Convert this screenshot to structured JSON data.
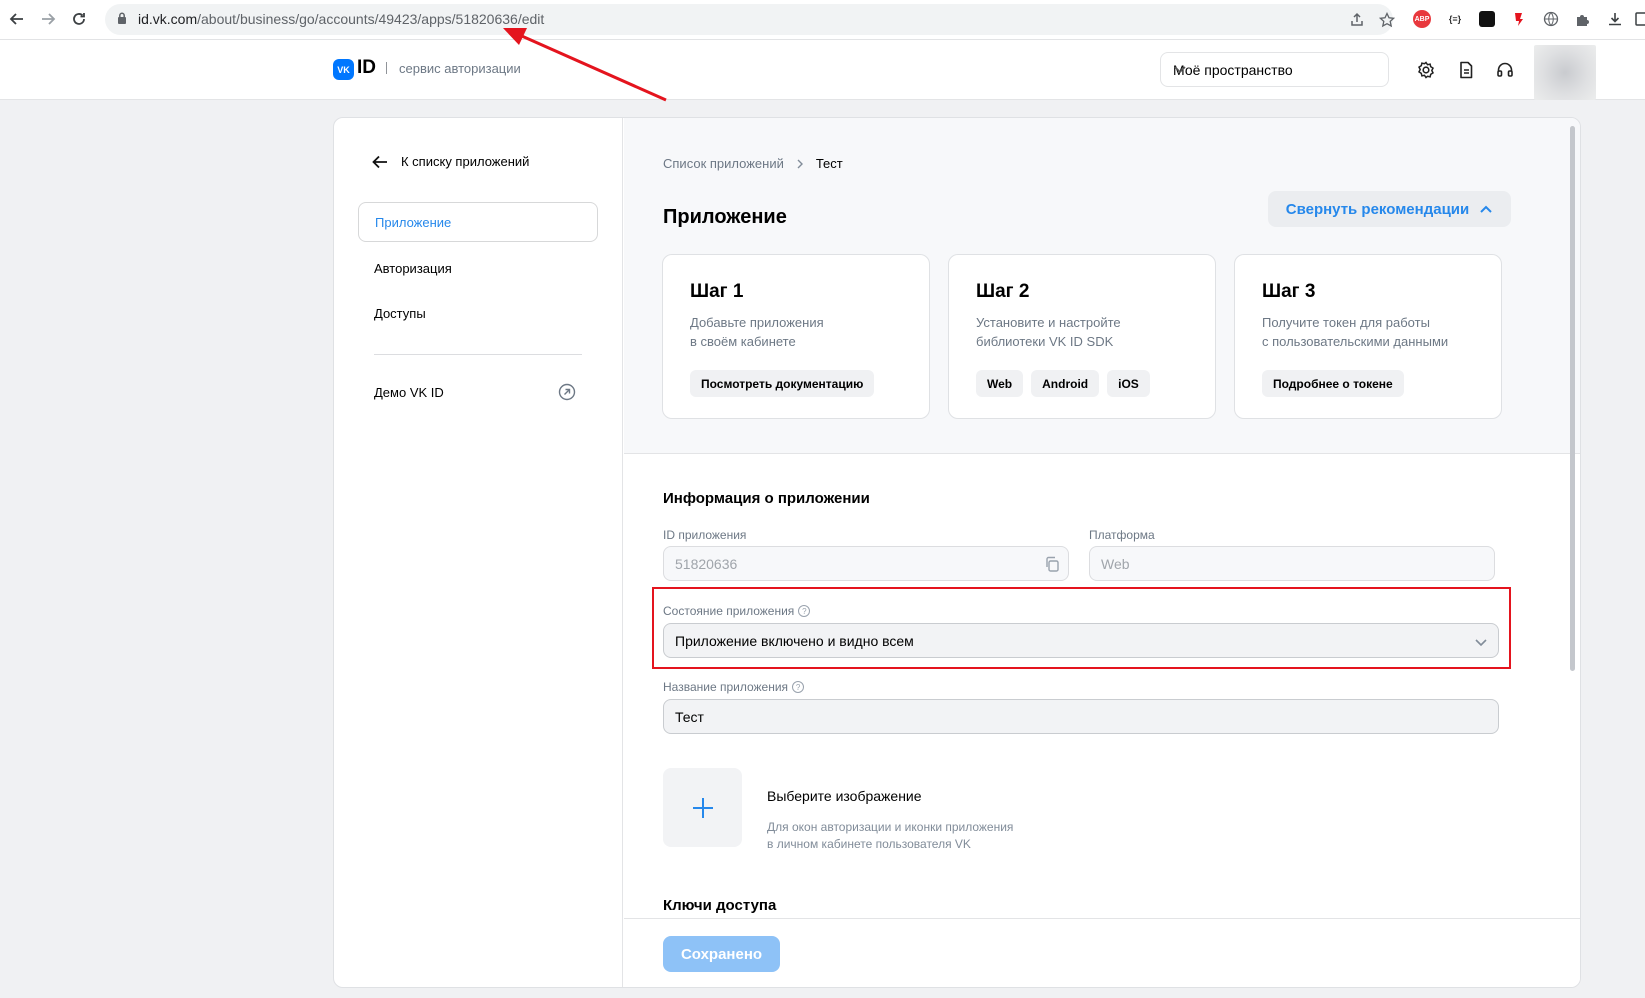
{
  "browser": {
    "url_host": "id.vk.com",
    "url_path": "/about/business/go/accounts/49423/apps/51820636/edit",
    "ext_abp": "ABP",
    "ext_json": "{≡}"
  },
  "header": {
    "logo_mark": "VK",
    "logo_text": "ID",
    "service_label": "сервис авторизации",
    "space_select": "Моё пространство"
  },
  "sidebar": {
    "back_label": "К списку приложений",
    "items": [
      {
        "label": "Приложение",
        "active": true
      },
      {
        "label": "Авторизация",
        "active": false
      },
      {
        "label": "Доступы",
        "active": false
      }
    ],
    "demo_label": "Демо VK ID"
  },
  "breadcrumbs": [
    "Список приложений",
    "Тест"
  ],
  "page_title": "Приложение",
  "collapse_label": "Свернуть рекомендации",
  "steps": [
    {
      "title": "Шаг 1",
      "desc": "Добавьте приложения\nв своём кабинете",
      "chips": [
        "Посмотреть документацию"
      ]
    },
    {
      "title": "Шаг 2",
      "desc": "Установите и настройте\nбиблиотеки VK ID SDK",
      "chips": [
        "Web",
        "Android",
        "iOS"
      ]
    },
    {
      "title": "Шаг 3",
      "desc": "Получите токен для работы\nс пользовательскими данными",
      "chips": [
        "Подробнее о токене"
      ]
    }
  ],
  "form": {
    "section_title": "Информация о приложении",
    "app_id_label": "ID приложения",
    "app_id_value": "51820636",
    "platform_label": "Платформа",
    "platform_value": "Web",
    "state_label": "Состояние приложения",
    "state_value": "Приложение включено и видно всем",
    "name_label": "Название приложения",
    "name_value": "Тест",
    "image_title": "Выберите изображение",
    "image_desc": "Для окон авторизации и иконки приложения\nв личном кабинете пользователя VK",
    "keys_title": "Ключи доступа"
  },
  "save_label": "Сохранено",
  "colors": {
    "accent": "#2688eb",
    "annotation": "#e4141e",
    "save_disabled": "#8ec2f7"
  }
}
